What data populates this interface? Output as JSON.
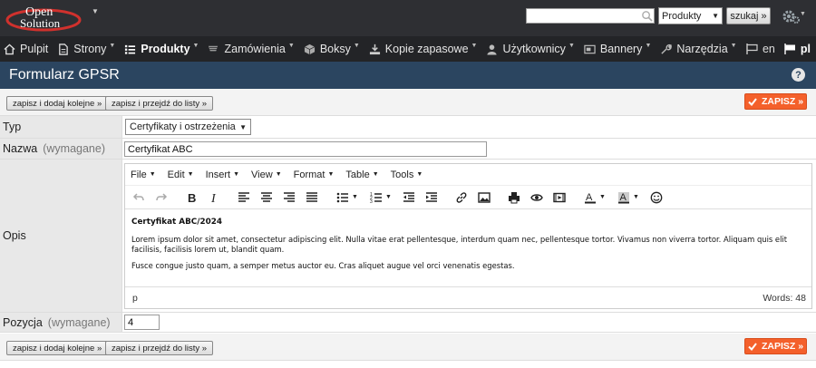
{
  "topbar": {
    "logo": "Open Solution",
    "search": {
      "value": "",
      "placeholder": ""
    },
    "search_scope": "Produkty",
    "search_button": "szukaj »"
  },
  "nav": {
    "items": [
      {
        "label": "Pulpit",
        "icon": "home-icon"
      },
      {
        "label": "Strony",
        "icon": "page-icon"
      },
      {
        "label": "Produkty",
        "icon": "list-icon"
      },
      {
        "label": "Zamówienia",
        "icon": "cart-icon"
      },
      {
        "label": "Boksy",
        "icon": "box-icon"
      },
      {
        "label": "Kopie zapasowe",
        "icon": "backup-icon"
      },
      {
        "label": "Użytkownicy",
        "icon": "user-icon"
      },
      {
        "label": "Bannery",
        "icon": "banner-icon"
      },
      {
        "label": "Narzędzia",
        "icon": "tools-icon"
      }
    ],
    "active_index": 2,
    "languages": [
      {
        "label": "en",
        "icon": "flag-icon"
      },
      {
        "label": "pl",
        "icon": "flag-icon"
      }
    ],
    "active_language": 1
  },
  "page": {
    "title": "Formularz GPSR",
    "help": "?"
  },
  "actions": {
    "save_and_add": "zapisz i dodaj kolejne »",
    "save_and_list": "zapisz i przejdź do listy »",
    "save": "ZAPISZ »"
  },
  "form": {
    "type": {
      "label": "Typ",
      "value": "Certyfikaty i ostrzeżenia"
    },
    "name": {
      "label": "Nazwa",
      "required": "(wymagane)",
      "value": "Certyfikat ABC"
    },
    "description": {
      "label": "Opis"
    },
    "position": {
      "label": "Pozycja",
      "required": "(wymagane)",
      "value": "4"
    }
  },
  "editor": {
    "menu": [
      "File",
      "Edit",
      "Insert",
      "View",
      "Format",
      "Table",
      "Tools"
    ],
    "toolbar": [
      "undo-icon",
      "redo-icon",
      "bold-icon",
      "italic-icon",
      "align-left-icon",
      "align-center-icon",
      "align-right-icon",
      "align-justify-icon",
      "bullet-list-icon",
      "numbered-list-icon",
      "outdent-icon",
      "indent-icon",
      "link-icon",
      "image-icon",
      "print-icon",
      "preview-icon",
      "media-icon",
      "text-color-icon",
      "background-color-icon",
      "emoticon-icon"
    ],
    "content": {
      "heading": "Certyfikat ABC/2024",
      "paragraph1": "Lorem ipsum dolor sit amet, consectetur adipiscing elit. Nulla vitae erat pellentesque, interdum quam nec, pellentesque tortor. Vivamus non viverra tortor. Aliquam quis elit facilisis, facilisis lorem ut, blandit quam.",
      "paragraph2": "Fusce congue justo quam, a semper metus auctor eu. Cras aliquet augue vel orci venenatis egestas."
    },
    "status_path": "p",
    "word_count": "Words: 48"
  },
  "colors": {
    "topbar": "#2e2f33",
    "nav": "#232427",
    "titlebar": "#2b4560",
    "save": "#f4602b"
  }
}
